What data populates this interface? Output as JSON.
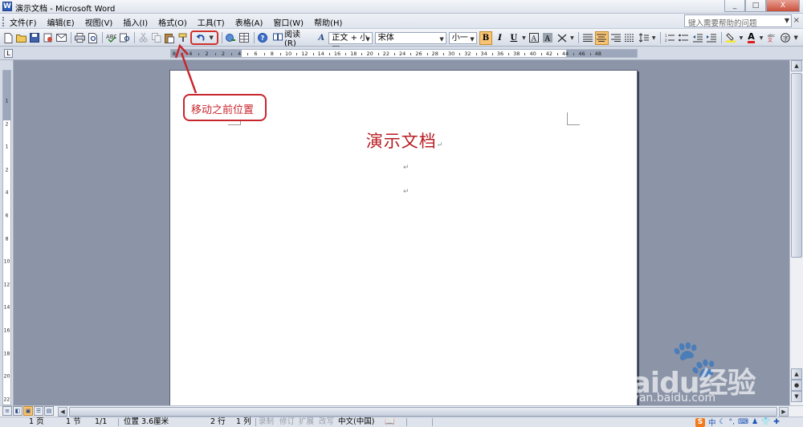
{
  "window": {
    "title": "演示文档 - Microsoft Word",
    "buttons": [
      "_",
      "□",
      "X"
    ]
  },
  "menubar": {
    "items": [
      "文件(F)",
      "编辑(E)",
      "视图(V)",
      "插入(I)",
      "格式(O)",
      "工具(T)",
      "表格(A)",
      "窗口(W)",
      "帮助(H)"
    ],
    "help_placeholder": "键入需要帮助的问题",
    "close_glyph": "×"
  },
  "toolbar": {
    "reading_label": "阅读(R)",
    "style_value": "正文 + 小一",
    "font_value": "宋体",
    "size_value": "小一",
    "bold_label": "B",
    "italic_label": "I",
    "underline_label": "U",
    "fontcolor_label": "A"
  },
  "ruler": {
    "labels": [
      "8",
      "4",
      "2",
      "2",
      "4",
      "6",
      "8",
      "10",
      "12",
      "14",
      "16",
      "18",
      "20",
      "22",
      "24",
      "26",
      "28",
      "30",
      "32",
      "34",
      "36",
      "38",
      "40",
      "42",
      "44",
      "46",
      "48"
    ]
  },
  "vruler": {
    "labels": [
      "1",
      "2",
      "1",
      "2",
      "4",
      "6",
      "8",
      "10",
      "12",
      "14",
      "16",
      "18",
      "20",
      "22"
    ]
  },
  "document": {
    "title": "演示文档",
    "pilcrow": "↵"
  },
  "annotation": {
    "text": "移动之前位置"
  },
  "statusbar": {
    "page": "1 页",
    "section": "1 节",
    "page_of": "1/1",
    "position": "位置 3.6厘米",
    "line": "2 行",
    "column": "1 列",
    "record": "录制",
    "revise": "修订",
    "extend": "扩展",
    "overtype": "改写",
    "language": "中文(中国)"
  },
  "ime": {
    "logo": "S",
    "mode": "中"
  },
  "watermark": {
    "brand": "Baidu经验",
    "url": "jingyan.baidu.com"
  }
}
